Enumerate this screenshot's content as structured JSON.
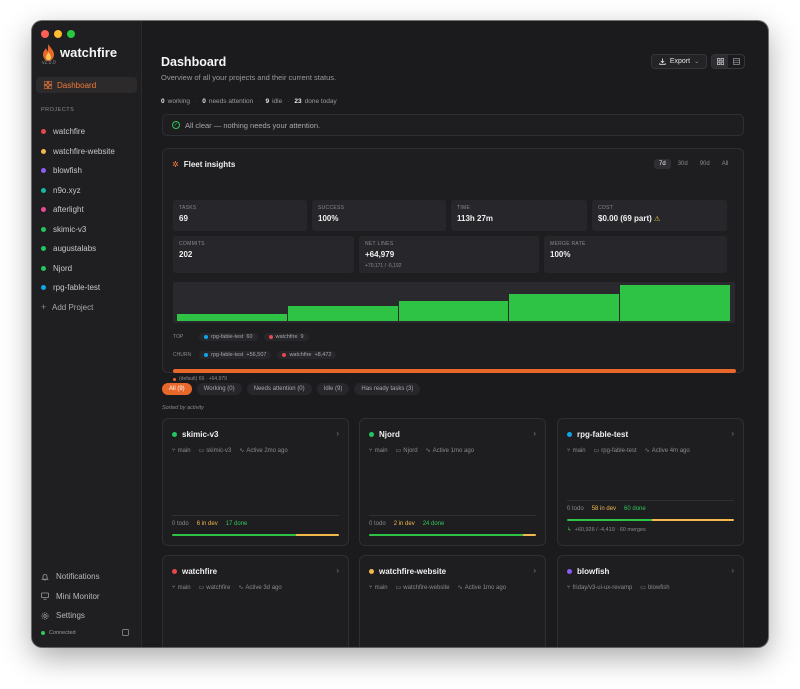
{
  "app": {
    "name": "watchfire",
    "version": "v2.0.0",
    "colors": {
      "accent": "#e8672b",
      "green": "#2ec344",
      "yellow": "#f2b84b"
    }
  },
  "sidebar": {
    "dashboard_label": "Dashboard",
    "projects_label": "PROJECTS",
    "projects": [
      {
        "name": "watchfire",
        "color": "#e5484d"
      },
      {
        "name": "watchfire-website",
        "color": "#f2b84b"
      },
      {
        "name": "blowfish",
        "color": "#8b5cf6"
      },
      {
        "name": "n9o.xyz",
        "color": "#14b8a6"
      },
      {
        "name": "afterlight",
        "color": "#ec4899"
      },
      {
        "name": "skimic-v3",
        "color": "#22c55e"
      },
      {
        "name": "augustalabs",
        "color": "#22c55e"
      },
      {
        "name": "Njord",
        "color": "#22c55e"
      },
      {
        "name": "rpg-fable-test",
        "color": "#0ea5e9"
      }
    ],
    "add_project_label": "Add Project",
    "bottom": {
      "notifications": "Notifications",
      "mini_monitor": "Mini Monitor",
      "settings": "Settings"
    },
    "connected_label": "Connected"
  },
  "header": {
    "title": "Dashboard",
    "subtitle": "Overview of all your projects and their current status.",
    "export_label": "Export"
  },
  "stats": {
    "working_n": "0",
    "working_l": "working",
    "attention_n": "0",
    "attention_l": "needs attention",
    "idle_n": "9",
    "idle_l": "idle",
    "done_n": "23",
    "done_l": "done today"
  },
  "all_clear": "All clear — nothing needs your attention.",
  "fleet": {
    "title": "Fleet insights",
    "ranges": [
      "7d",
      "30d",
      "90d",
      "All"
    ],
    "tiles": {
      "tasks": {
        "label": "TASKS",
        "value": "69"
      },
      "success": {
        "label": "SUCCESS",
        "value": "100%"
      },
      "time": {
        "label": "TIME",
        "value": "113h 27m"
      },
      "cost": {
        "label": "COST",
        "value": "$0.00 (69 part)"
      },
      "commits": {
        "label": "COMMITS",
        "value": "202"
      },
      "net_lines": {
        "label": "NET LINES",
        "value": "+64,979",
        "sub": "+70,171 / -5,192"
      },
      "merge_rate": {
        "label": "MERGE RATE",
        "value": "100%"
      }
    },
    "bars": [
      0.18,
      0.4,
      0.54,
      0.72,
      0.96
    ],
    "top_label": "TOP",
    "top": [
      {
        "name": "rpg-fable-test",
        "value": "60",
        "color": "#0ea5e9"
      },
      {
        "name": "watchfire",
        "value": "9",
        "color": "#e5484d"
      }
    ],
    "churn_label": "CHURN",
    "churn": [
      {
        "name": "rpg-fable-test",
        "value": "+56,507",
        "color": "#0ea5e9"
      },
      {
        "name": "watchfire",
        "value": "+8,472",
        "color": "#e5484d"
      }
    ],
    "default_line": "(default) 69 · +64,979"
  },
  "filters": [
    {
      "label": "All",
      "count": "(9)",
      "on": true
    },
    {
      "label": "Working",
      "count": "(0)",
      "on": false
    },
    {
      "label": "Needs attention",
      "count": "(0)",
      "on": false
    },
    {
      "label": "Idle",
      "count": "(9)",
      "on": false
    },
    {
      "label": "Has ready tasks",
      "count": "(3)",
      "on": false
    }
  ],
  "sorted_label": "Sorted by activity",
  "cards": [
    {
      "name": "skimic-v3",
      "color": "#22c55e",
      "branch": "main",
      "folder": "skimic-v3",
      "active": "Active 2mo ago",
      "todo": "0 todo",
      "dev": "6 in dev",
      "done": "17 done",
      "progress": {
        "done": 0.74,
        "dev": 0.26
      }
    },
    {
      "name": "Njord",
      "color": "#22c55e",
      "branch": "main",
      "folder": "Njord",
      "active": "Active 1mo ago",
      "todo": "0 todo",
      "dev": "2 in dev",
      "done": "24 done",
      "progress": {
        "done": 0.92,
        "dev": 0.08
      }
    },
    {
      "name": "rpg-fable-test",
      "color": "#0ea5e9",
      "branch": "main",
      "folder": "rpg-fable-test",
      "active": "Active 4m ago",
      "todo": "0 todo",
      "dev": "58 in dev",
      "done": "60 done",
      "progress": {
        "done": 0.51,
        "dev": 0.49
      },
      "merges": "+60,926 / -4,419 · 60 merges"
    },
    {
      "name": "watchfire",
      "color": "#e5484d",
      "branch": "main",
      "folder": "watchfire",
      "active": "Active 3d ago"
    },
    {
      "name": "watchfire-website",
      "color": "#f2b84b",
      "branch": "main",
      "folder": "watchfire-website",
      "active": "Active 1mo ago"
    },
    {
      "name": "blowfish",
      "color": "#8b5cf6",
      "branch": "friday/v3-ui-ux-revamp",
      "folder": "blowfish",
      "active": ""
    }
  ]
}
